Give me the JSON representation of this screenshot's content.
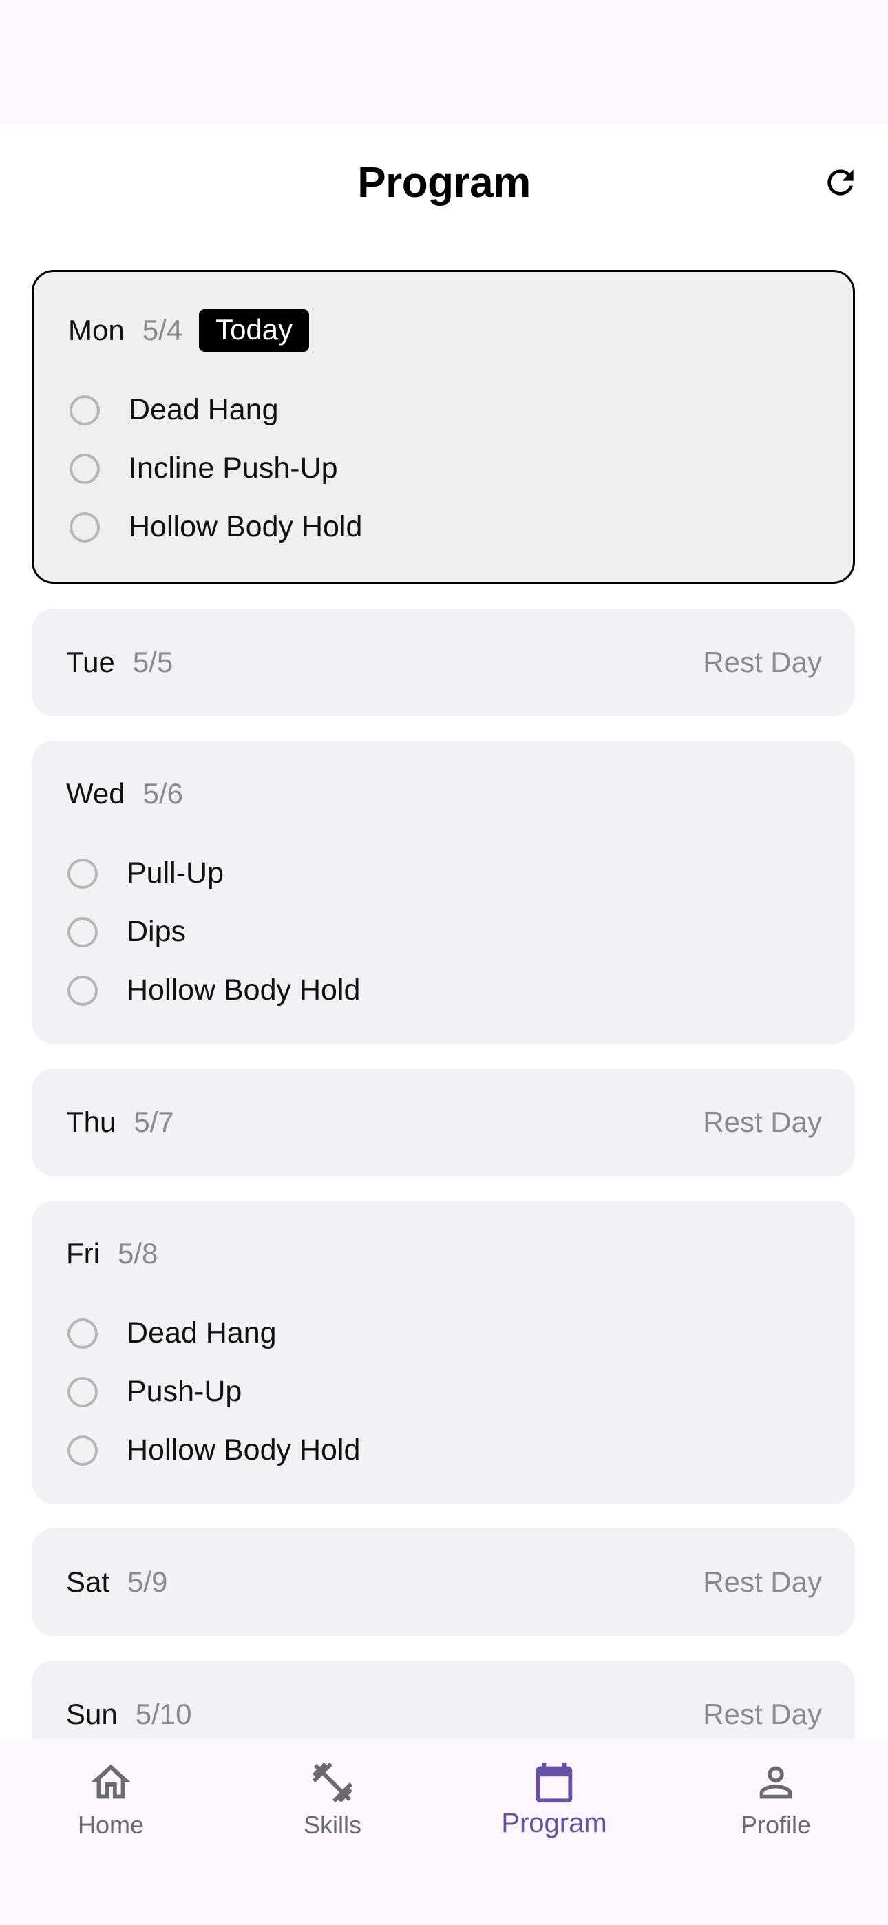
{
  "header": {
    "title": "Program",
    "refresh_icon": "refresh-icon"
  },
  "days": [
    {
      "name": "Mon",
      "date": "5/4",
      "badge": "Today",
      "exercises": [
        "Dead Hang",
        "Incline Push-Up",
        "Hollow Body Hold"
      ]
    },
    {
      "name": "Tue",
      "date": "5/5",
      "rest": "Rest Day"
    },
    {
      "name": "Wed",
      "date": "5/6",
      "exercises": [
        "Pull-Up",
        "Dips",
        "Hollow Body Hold"
      ]
    },
    {
      "name": "Thu",
      "date": "5/7",
      "rest": "Rest Day"
    },
    {
      "name": "Fri",
      "date": "5/8",
      "exercises": [
        "Dead Hang",
        "Push-Up",
        "Hollow Body Hold"
      ]
    },
    {
      "name": "Sat",
      "date": "5/9",
      "rest": "Rest Day"
    },
    {
      "name": "Sun",
      "date": "5/10",
      "rest": "Rest Day"
    }
  ],
  "nav": {
    "items": [
      {
        "label": "Home",
        "icon": "home-icon"
      },
      {
        "label": "Skills",
        "icon": "dumbbell-icon"
      },
      {
        "label": "Program",
        "icon": "calendar-icon",
        "active": true
      },
      {
        "label": "Profile",
        "icon": "person-icon"
      }
    ]
  },
  "colors": {
    "accent": "#6750a4",
    "card_bg": "#f2f1f6",
    "today_card_bg": "#efefef",
    "nav_bg": "#fdf7fd",
    "muted_text": "#8a8a8e"
  }
}
